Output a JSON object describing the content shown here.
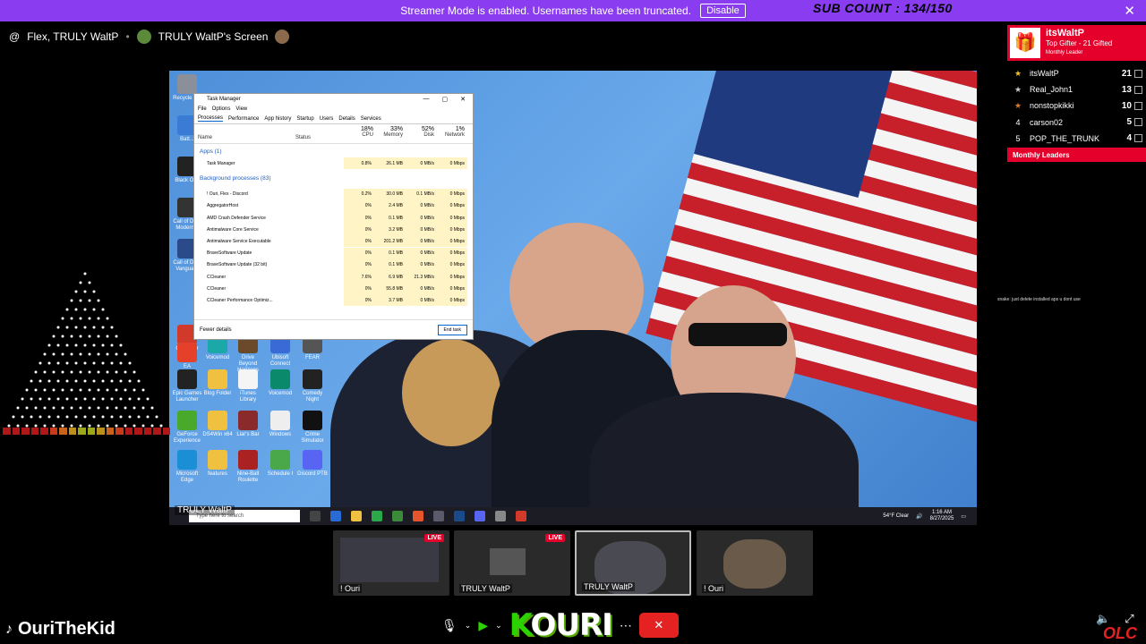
{
  "banner": {
    "message": "Streamer Mode is enabled. Usernames have been truncated.",
    "disable_label": "Disable",
    "close": "✕",
    "sub_count": "SUB COUNT : 134/150"
  },
  "header": {
    "channel": "Flex, TRULY WaltP",
    "screen_title": "TRULY WaltP's Screen"
  },
  "task_manager": {
    "title": "Task Manager",
    "menu": [
      "File",
      "Options",
      "View"
    ],
    "tabs": [
      "Processes",
      "Performance",
      "App history",
      "Startup",
      "Users",
      "Details",
      "Services"
    ],
    "columns": {
      "name": "Name",
      "status": "Status",
      "cpu_pct": "18%",
      "cpu": "CPU",
      "mem_pct": "33%",
      "mem": "Memory",
      "disk_pct": "52%",
      "disk": "Disk",
      "net_pct": "1%",
      "net": "Network"
    },
    "rows": [
      {
        "name": "Apps (1)",
        "head": true,
        "cpu": "",
        "mem": "",
        "disk": "",
        "net": ""
      },
      {
        "name": "Task Manager",
        "cpu": "0.8%",
        "mem": "26.1 MB",
        "disk": "0 MB/s",
        "net": "0 Mbps"
      },
      {
        "name": "Background processes (83)",
        "head": true,
        "cpu": "",
        "mem": "",
        "disk": "",
        "net": ""
      },
      {
        "name": "! Ouri, Flex - Discord",
        "cpu": "0.2%",
        "mem": "30.0 MB",
        "disk": "0.1 MB/s",
        "net": "0 Mbps"
      },
      {
        "name": "AggregatorHost",
        "cpu": "0%",
        "mem": "2.4 MB",
        "disk": "0 MB/s",
        "net": "0 Mbps"
      },
      {
        "name": "AMD Crash Defender Service",
        "cpu": "0%",
        "mem": "0.1 MB",
        "disk": "0 MB/s",
        "net": "0 Mbps"
      },
      {
        "name": "Antimalware Core Service",
        "cpu": "0%",
        "mem": "3.2 MB",
        "disk": "0 MB/s",
        "net": "0 Mbps"
      },
      {
        "name": "Antimalware Service Executable",
        "cpu": "0%",
        "mem": "201.2 MB",
        "disk": "0 MB/s",
        "net": "0 Mbps"
      },
      {
        "name": "BraveSoftware Update",
        "cpu": "0%",
        "mem": "0.1 MB",
        "disk": "0 MB/s",
        "net": "0 Mbps"
      },
      {
        "name": "BraveSoftware Update (32 bit)",
        "cpu": "0%",
        "mem": "0.1 MB",
        "disk": "0 MB/s",
        "net": "0 Mbps"
      },
      {
        "name": "CCleaner",
        "cpu": "7.6%",
        "mem": "6.9 MB",
        "disk": "21.3 MB/s",
        "net": "0 Mbps"
      },
      {
        "name": "CCleaner",
        "cpu": "0%",
        "mem": "55.8 MB",
        "disk": "0 MB/s",
        "net": "0 Mbps"
      },
      {
        "name": "CCleaner Performance Optimiz...",
        "cpu": "0%",
        "mem": "3.7 MB",
        "disk": "0 MB/s",
        "net": "0 Mbps"
      }
    ],
    "fewer_details": "Fewer details",
    "end_task": "End task"
  },
  "desktop_icons": [
    {
      "label": "Recycle Bin",
      "color": "#8a8f99"
    },
    {
      "label": "Batt...",
      "color": "#3a7bd5"
    },
    {
      "label": "Black Ops",
      "color": "#222222"
    },
    {
      "label": "Call of Du... Modern...",
      "color": "#333333"
    },
    {
      "label": "Call of Du... Vanguard",
      "color": "#2a4a8a"
    },
    {
      "label": "CCleaner",
      "color": "#d13a2a"
    },
    {
      "label": "EA",
      "color": "#e5412a"
    },
    {
      "label": "Epic Games Launcher",
      "color": "#222222"
    },
    {
      "label": "GeForce Experience",
      "color": "#4aa82a"
    },
    {
      "label": "Microsoft Edge",
      "color": "#1a8fd5"
    },
    {
      "label": "Voicemod",
      "color": "#1aa8a8"
    },
    {
      "label": "Drive Beyond Horizons",
      "color": "#6a4a2a"
    },
    {
      "label": "Ubisoft Connect",
      "color": "#3a6ad5"
    },
    {
      "label": "FEAR",
      "color": "#555555"
    },
    {
      "label": "Blog Folder",
      "color": "#f0c040"
    },
    {
      "label": "iTunes Library",
      "color": "#f5f5f5"
    },
    {
      "label": "Voicemod",
      "color": "#0a8a6a"
    },
    {
      "label": "Comedy Night",
      "color": "#222222"
    },
    {
      "label": "DS4Win x64",
      "color": "#f0c040"
    },
    {
      "label": "Liar's Bar",
      "color": "#8a2a2a"
    },
    {
      "label": "Windows",
      "color": "#eeeeee"
    },
    {
      "label": "Crime Simulator",
      "color": "#111111"
    },
    {
      "label": "features",
      "color": "#f0c040"
    },
    {
      "label": "Nine-Ball Roulette",
      "color": "#aa2222"
    },
    {
      "label": "Schedule I",
      "color": "#4aa84a"
    },
    {
      "label": "Discord PTB",
      "color": "#5865f2"
    }
  ],
  "taskbar": {
    "search_placeholder": "Type here to search",
    "weather": "54°F Clear",
    "time": "1:16 AM",
    "date": "8/27/2025",
    "screen_label": "TRULY WaltP"
  },
  "right_panel": {
    "top_gifter_name": "itsWaltP",
    "top_gifter_sub": "Top Gifter - 21 Gifted",
    "top_gifter_sub2": "Monthly Leader",
    "leaders": [
      {
        "rank": "★",
        "name": "itsWaltP",
        "count": "21",
        "color": "#f0c020"
      },
      {
        "rank": "★",
        "name": "Real_John1",
        "count": "13",
        "color": "#c8c8c8"
      },
      {
        "rank": "★",
        "name": "nonstopkikki",
        "count": "10",
        "color": "#d97a2a"
      },
      {
        "rank": "4",
        "name": "carson02",
        "count": "5",
        "color": "#ffffff"
      },
      {
        "rank": "5",
        "name": "POP_THE_TRUNK",
        "count": "4",
        "color": "#ffffff"
      }
    ],
    "monthly_leaders": "Monthly Leaders",
    "chat_line": "snake: just delete installed aps u dont use"
  },
  "tiles": [
    {
      "label": "! Ouri",
      "live": "LIVE"
    },
    {
      "label": "TRULY WaltP",
      "live": "LIVE"
    },
    {
      "label": "TRULY WaltP",
      "live": ""
    },
    {
      "label": "! Ouri",
      "live": ""
    }
  ],
  "bottom": {
    "streamer": "OuriTheKid",
    "overlay_name": "OURI",
    "overlay_name_first": "K",
    "logo": "OLC"
  }
}
